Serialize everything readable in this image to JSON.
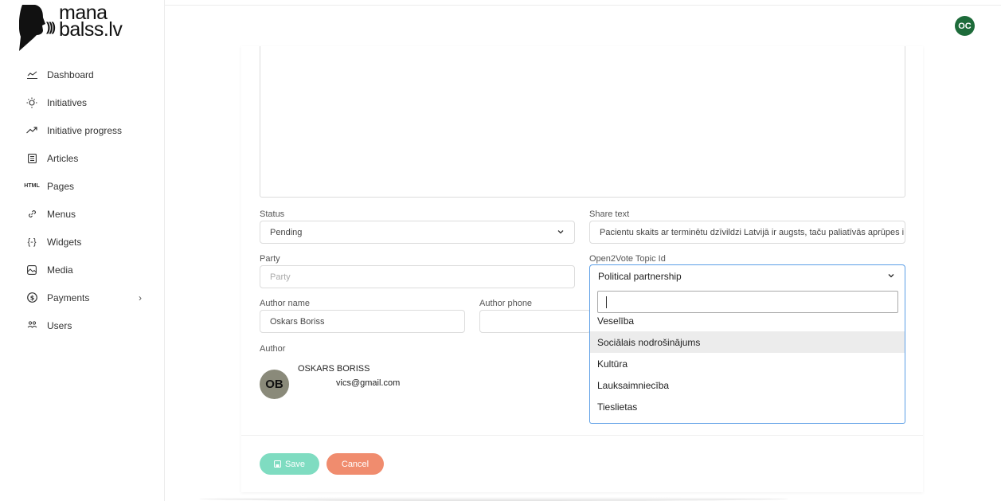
{
  "brand": {
    "line1": "mana",
    "line2": "balss.lv"
  },
  "user": {
    "initials": "OC"
  },
  "sidebar": {
    "items": [
      {
        "label": "Dashboard",
        "icon": "chart-line-icon"
      },
      {
        "label": "Initiatives",
        "icon": "lightbulb-icon"
      },
      {
        "label": "Initiative progress",
        "icon": "trending-up-icon"
      },
      {
        "label": "Articles",
        "icon": "article-icon"
      },
      {
        "label": "Pages",
        "icon": "html-icon"
      },
      {
        "label": "Menus",
        "icon": "link-icon"
      },
      {
        "label": "Widgets",
        "icon": "widget-braces-icon"
      },
      {
        "label": "Media",
        "icon": "image-icon"
      },
      {
        "label": "Payments",
        "icon": "dollar-circle-icon"
      },
      {
        "label": "Users",
        "icon": "users-icon"
      }
    ]
  },
  "form": {
    "status": {
      "label": "Status",
      "value": "Pending"
    },
    "share_text": {
      "label": "Share text",
      "value": "Pacientu skaits ar terminētu dzīvildzi Latvijā ir augsts, taču paliatīvās aprūpes i"
    },
    "party": {
      "label": "Party",
      "placeholder": "Party"
    },
    "open2vote": {
      "label": "Open2Vote Topic Id",
      "value": "Political partnership"
    },
    "author_name": {
      "label": "Author name",
      "value": "Oskars Boriss"
    },
    "author_phone": {
      "label": "Author phone",
      "value": ""
    },
    "author": {
      "label": "Author",
      "initials": "OB",
      "name": "OSKARS BORISS",
      "email": "vics@gmail.com"
    },
    "save_label": "Save",
    "cancel_label": "Cancel"
  },
  "dropdown": {
    "search_value": "",
    "options": [
      "Veselība",
      "Sociālais nodrošinājums",
      "Kultūra",
      "Lauksaimniecība",
      "Tieslietas"
    ],
    "highlighted": "Sociālais nodrošinājums"
  },
  "colors": {
    "save": "#7fdcc1",
    "cancel": "#f08c6e",
    "avatar_top": "#1d6b3a",
    "focus": "#5b9ee6"
  }
}
